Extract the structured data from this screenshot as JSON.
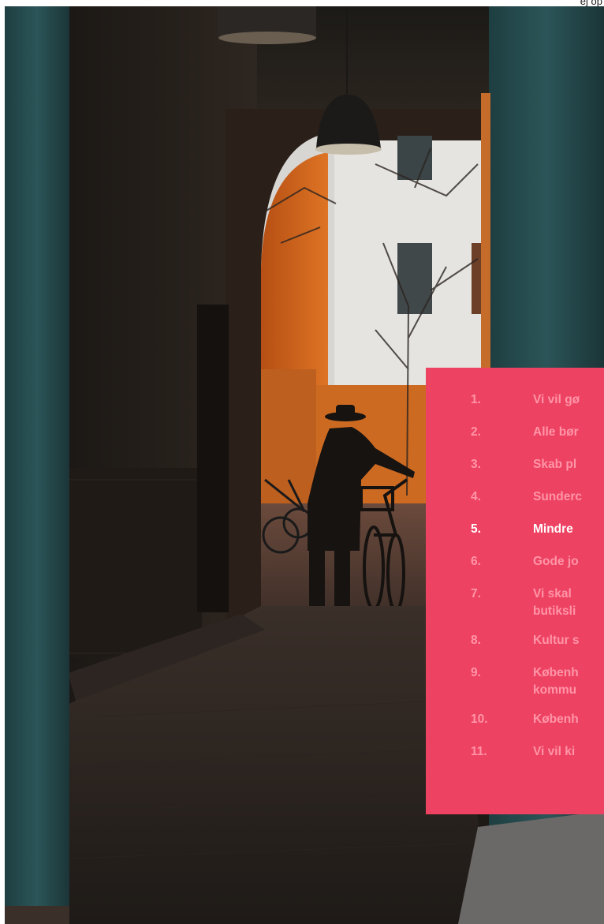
{
  "header": {
    "corner_text": "ej op"
  },
  "photo": {
    "description_icon": "photo-copenhagen-passage"
  },
  "menu": {
    "accent_color": "#ee4262",
    "inactive_text_color": "#ff95a7",
    "active_text_color": "#ffffff",
    "active_index": 4,
    "items": [
      {
        "number": "1.",
        "label": "Vi vil gø"
      },
      {
        "number": "2.",
        "label": "Alle bør"
      },
      {
        "number": "3.",
        "label": "Skab pl"
      },
      {
        "number": "4.",
        "label": "Sunderc"
      },
      {
        "number": "5.",
        "label": "Mindre"
      },
      {
        "number": "6.",
        "label": "Gode jo"
      },
      {
        "number": "7.",
        "label": "Vi skal",
        "label2": "butiksli"
      },
      {
        "number": "8.",
        "label": "Kultur s"
      },
      {
        "number": "9.",
        "label": "Københ",
        "label2": "kommu"
      },
      {
        "number": "10.",
        "label": "Københ"
      },
      {
        "number": "11.",
        "label": "Vi vil ki"
      }
    ]
  }
}
